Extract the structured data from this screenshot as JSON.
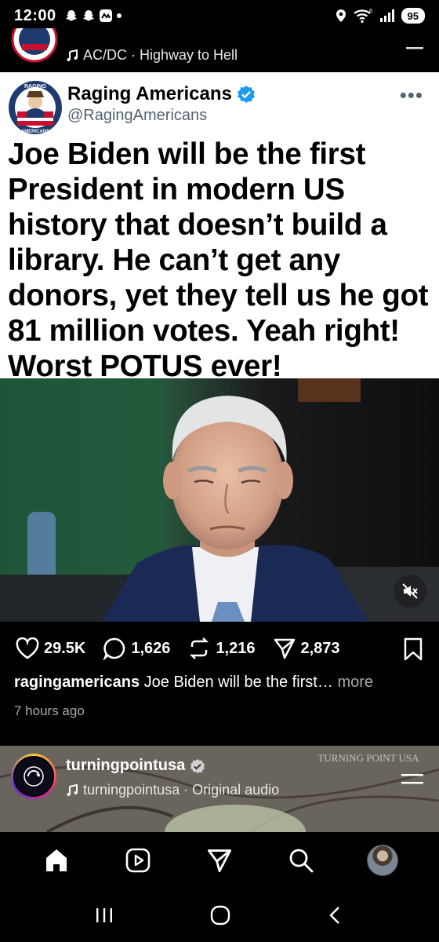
{
  "status_bar": {
    "time": "12:00",
    "battery": "95"
  },
  "previous_post": {
    "audio_label": "AC/DC · Highway to Hell"
  },
  "tweet": {
    "display_name": "Raging Americans",
    "handle": "@RagingAmericans",
    "avatar_text_top": "RAGING",
    "avatar_text_bottom": "AMERICANS",
    "text": "Joe Biden will be the first President in modern US history that doesn’t build a library. He can’t get any donors, yet they tell us he got 81 million votes. Yeah right! Worst POTUS ever!"
  },
  "actions": {
    "likes": "29.5K",
    "comments": "1,626",
    "reposts": "1,216",
    "shares": "2,873"
  },
  "caption": {
    "username": "ragingamericans",
    "text": "Joe Biden will be the first…",
    "more_label": "more",
    "timestamp": "7 hours ago"
  },
  "next_post": {
    "username": "turningpointusa",
    "audio_label": "turningpointusa · Original audio",
    "watermark": "TURNING POINT USA"
  },
  "colors": {
    "verified": "#1d9bf0",
    "ig_verified": "#0095f6",
    "background": "#000000"
  }
}
